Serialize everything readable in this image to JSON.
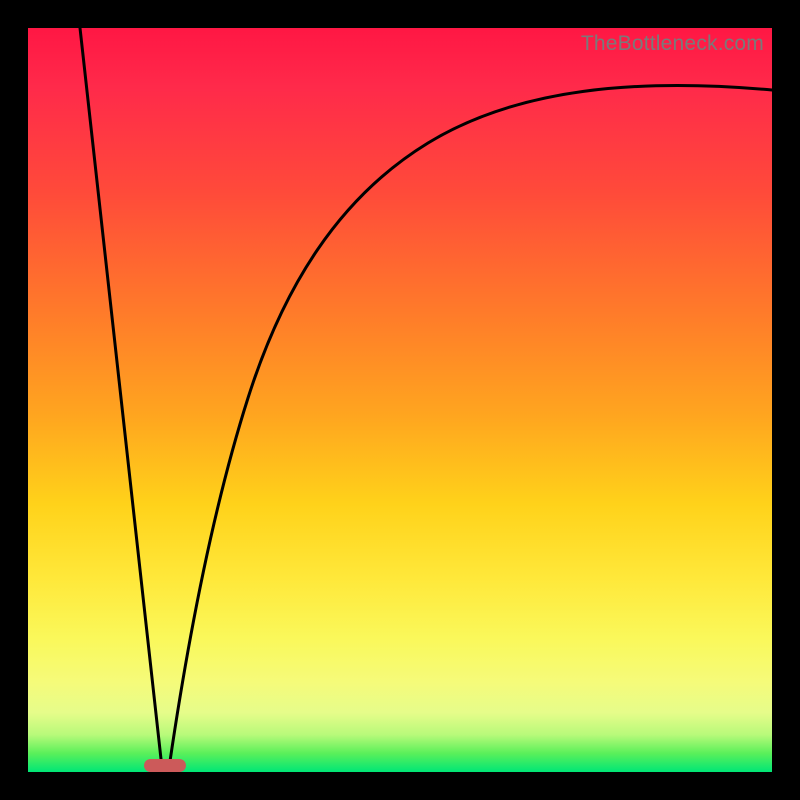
{
  "watermark": "TheBottleneck.com",
  "chart_data": {
    "type": "line",
    "title": "",
    "xlabel": "",
    "ylabel": "",
    "xlim": [
      0,
      100
    ],
    "ylim": [
      0,
      100
    ],
    "grid": false,
    "series": [
      {
        "name": "left-slope",
        "x": [
          7,
          18
        ],
        "y": [
          100,
          0
        ]
      },
      {
        "name": "right-curve",
        "x": [
          19,
          22,
          26,
          30,
          34,
          40,
          48,
          58,
          70,
          85,
          100
        ],
        "y": [
          0,
          22,
          42,
          55,
          64,
          72,
          79,
          84,
          88,
          90.5,
          92
        ]
      }
    ],
    "marker": {
      "x": 18.3,
      "y": 0.5,
      "color": "#cc5a5a"
    },
    "gradient_colors": [
      "#ff1744",
      "#ff7a2a",
      "#ffd21a",
      "#faf85a",
      "#5af05a",
      "#00e676"
    ]
  }
}
